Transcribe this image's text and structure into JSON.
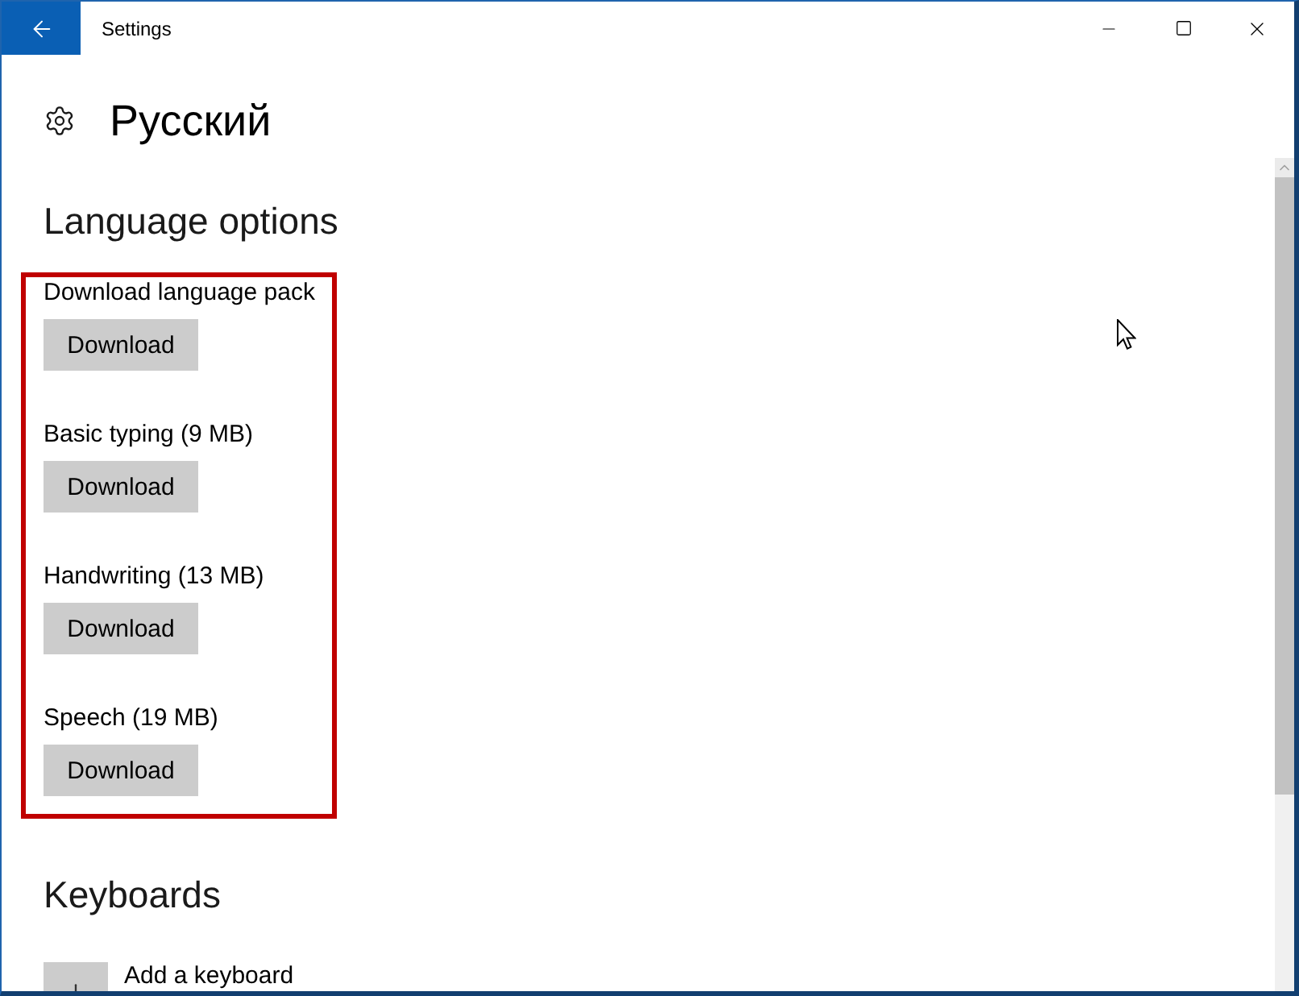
{
  "window": {
    "title": "Settings"
  },
  "page": {
    "title": "Русский"
  },
  "language_options": {
    "heading": "Language options",
    "highlighted": true,
    "items": [
      {
        "label": "Download language pack",
        "button": "Download"
      },
      {
        "label": "Basic typing (9 MB)",
        "button": "Download"
      },
      {
        "label": "Handwriting (13 MB)",
        "button": "Download"
      },
      {
        "label": "Speech (19 MB)",
        "button": "Download"
      }
    ]
  },
  "keyboards": {
    "heading": "Keyboards",
    "add_button": "Add a keyboard"
  }
}
